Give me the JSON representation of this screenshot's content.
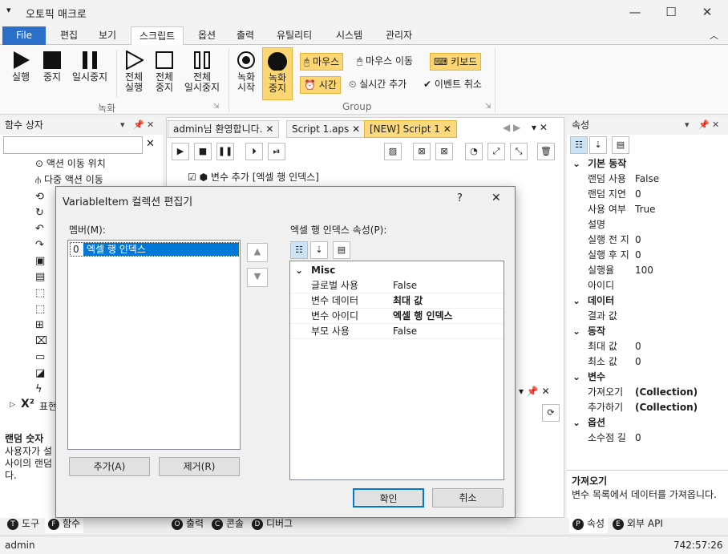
{
  "window": {
    "title": "오토픽 매크로",
    "minimize": "—",
    "maximize": "☐",
    "close": "✕"
  },
  "ribbon_tabs": [
    "File",
    "편집",
    "보기",
    "스크립트",
    "옵션",
    "출력",
    "유틸리티",
    "시스템",
    "관리자"
  ],
  "ribbon": {
    "run": "실행",
    "stop": "중지",
    "pause": "일시중지",
    "all_run": [
      "전체",
      "실행"
    ],
    "all_stop": [
      "전체",
      "중지"
    ],
    "all_pause": [
      "전체",
      "일시중지"
    ],
    "rec_start": [
      "녹화",
      "시작"
    ],
    "rec_stop": [
      "녹화",
      "중지"
    ],
    "group_record": "녹화",
    "mouse": "마우스",
    "mouse_move": "마우스 이동",
    "keyboard": "키보드",
    "time": "시간",
    "realtime_add": "실시간 추가",
    "event_cancel": "이벤트 취소",
    "group_group": "Group"
  },
  "left_panel": {
    "title": "함수 상자",
    "search_value": "",
    "items": [
      "액션 이동 위치",
      "다중 액션 이동"
    ],
    "tail_item": "표현",
    "desc_title": "랜덤 숫자",
    "desc_lines": [
      "사용자가 설",
      "사이의 랜덤",
      "다."
    ]
  },
  "doc_tabs": {
    "tab1": "admin님 환영합니다.",
    "tab2": "Script 1.aps",
    "tab3": "[NEW] Script 1",
    "script_line": "변수 추가 [엑셀 행 인덱스]"
  },
  "right_panel": {
    "title": "속성",
    "rows": [
      {
        "cat": true,
        "k": "기본 동작",
        "v": ""
      },
      {
        "cat": false,
        "k": "랜덤 사용",
        "v": "False"
      },
      {
        "cat": false,
        "k": "랜덤 지연",
        "v": "0"
      },
      {
        "cat": false,
        "k": "사용 여부",
        "v": "True"
      },
      {
        "cat": false,
        "k": "설명",
        "v": ""
      },
      {
        "cat": false,
        "k": "실행 전 지",
        "v": "0"
      },
      {
        "cat": false,
        "k": "실행 후 지",
        "v": "0"
      },
      {
        "cat": false,
        "k": "실행율",
        "v": "100"
      },
      {
        "cat": false,
        "k": "아이디",
        "v": ""
      },
      {
        "cat": true,
        "k": "데이터",
        "v": ""
      },
      {
        "cat": false,
        "k": "결과 값",
        "v": ""
      },
      {
        "cat": true,
        "k": "동작",
        "v": ""
      },
      {
        "cat": false,
        "k": "최대 값",
        "v": "0"
      },
      {
        "cat": false,
        "k": "최소 값",
        "v": "0"
      },
      {
        "cat": true,
        "k": "변수",
        "v": ""
      },
      {
        "cat": false,
        "k": "가져오기",
        "v": "(Collection)"
      },
      {
        "cat": false,
        "k": "추가하기",
        "v": "(Collection)"
      },
      {
        "cat": true,
        "k": "옵션",
        "v": ""
      },
      {
        "cat": false,
        "k": "소수점 길",
        "v": "0"
      }
    ],
    "desc_title": "가져오기",
    "desc_text": "변수 목록에서 데이터를 가져옵니다."
  },
  "bottom_tabs": {
    "tools": "도구",
    "functions": "함수",
    "output": "출력",
    "console": "콘솔",
    "debug": "디버그",
    "props": "속성",
    "ext_api": "외부 API"
  },
  "status": {
    "user": "admin",
    "time": "742:57:26"
  },
  "dialog": {
    "title": "VariableItem 컬렉션 편집기",
    "help": "?",
    "close": "✕",
    "members_label": "멤버(M):",
    "member_index": "0",
    "member_name": "엑셀 행 인덱스",
    "props_label": "엑셀 행 인덱스 속성(P):",
    "category": "Misc",
    "props": [
      {
        "k": "글로벌 사용",
        "v": "False",
        "bold": false
      },
      {
        "k": "변수 데이터",
        "v": "최대 값",
        "bold": true
      },
      {
        "k": "변수 아이디",
        "v": "엑셀 행 인덱스",
        "bold": true
      },
      {
        "k": "부모 사용",
        "v": "False",
        "bold": false
      }
    ],
    "add": "추가(A)",
    "remove": "제거(R)",
    "ok": "확인",
    "cancel": "취소"
  }
}
